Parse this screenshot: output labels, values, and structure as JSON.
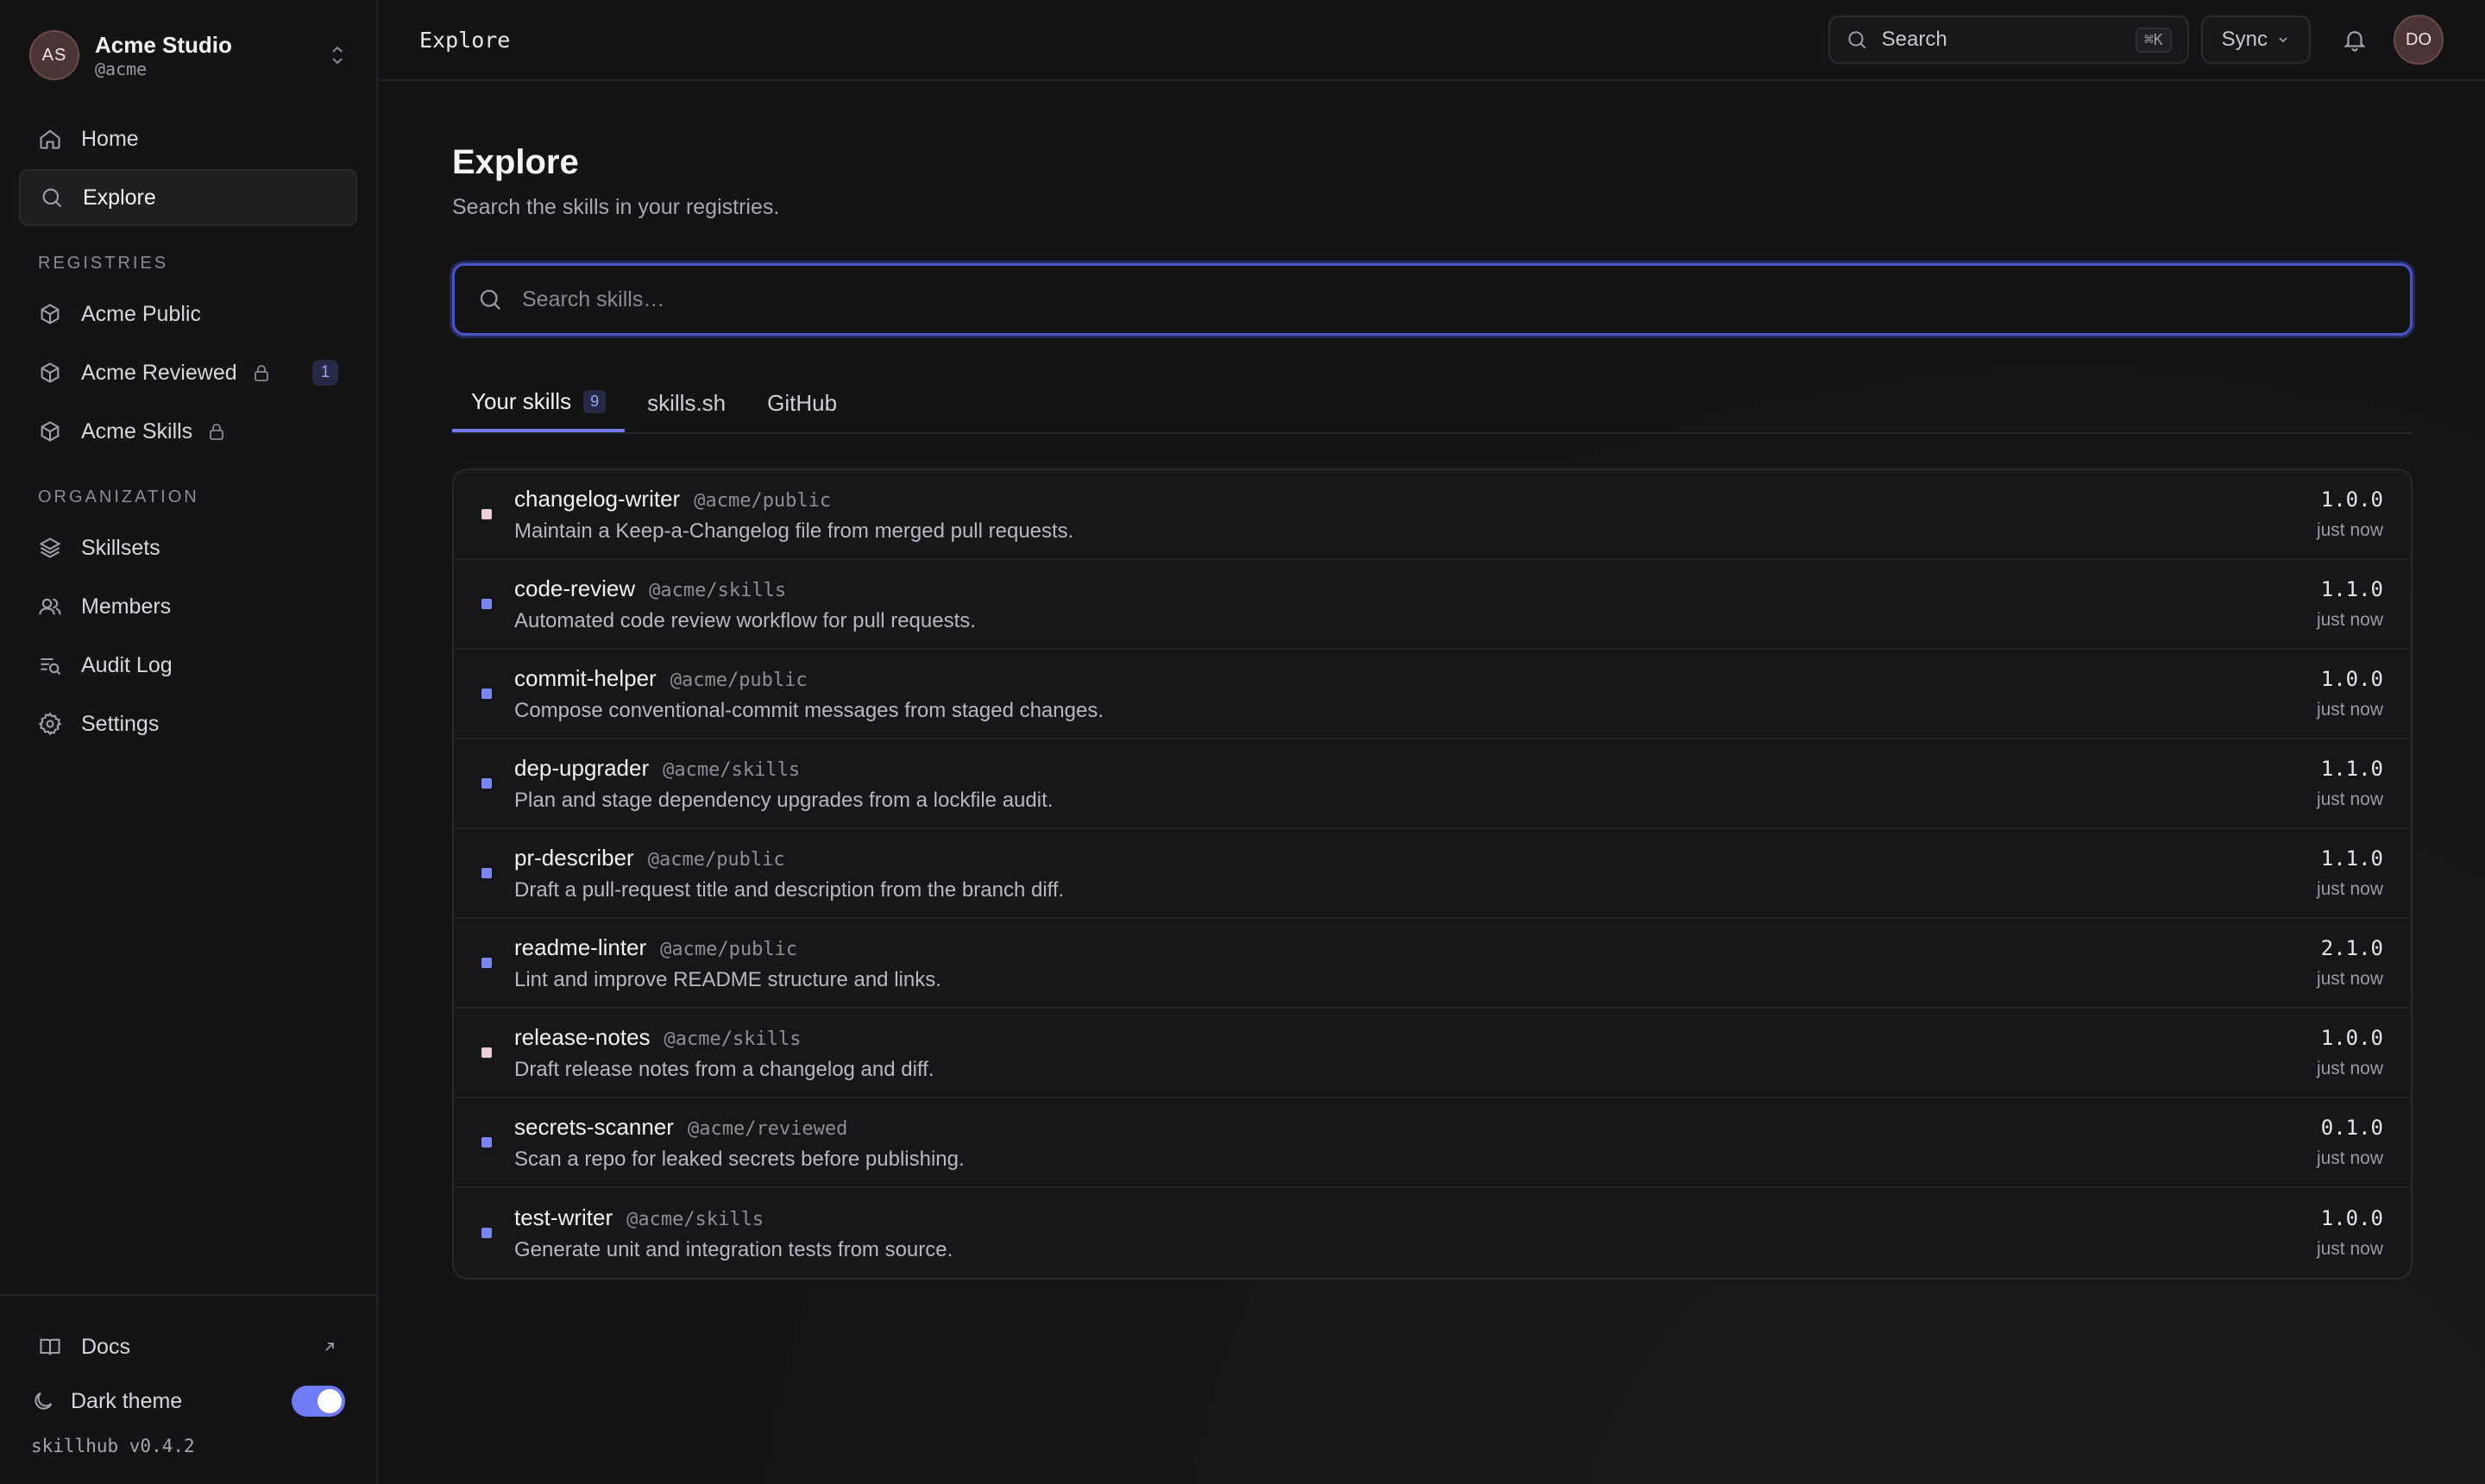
{
  "org": {
    "initials": "AS",
    "name": "Acme Studio",
    "handle": "@acme"
  },
  "nav": [
    {
      "label": "Home",
      "icon": "home-icon"
    },
    {
      "label": "Explore",
      "icon": "search-icon",
      "active": true
    }
  ],
  "registries": {
    "label": "REGISTRIES",
    "items": [
      {
        "label": "Acme Public",
        "icon": "package-icon",
        "locked": false
      },
      {
        "label": "Acme Reviewed",
        "icon": "package-icon",
        "locked": true,
        "count": "1"
      },
      {
        "label": "Acme Skills",
        "icon": "package-icon",
        "locked": true
      }
    ]
  },
  "organization": {
    "label": "ORGANIZATION",
    "items": [
      {
        "label": "Skillsets",
        "icon": "layers-icon"
      },
      {
        "label": "Members",
        "icon": "users-icon"
      },
      {
        "label": "Audit Log",
        "icon": "audit-log-icon"
      },
      {
        "label": "Settings",
        "icon": "gear-icon"
      }
    ]
  },
  "footer": {
    "docs_label": "Docs",
    "theme_label": "Dark theme",
    "theme_on": true,
    "version": "skillhub v0.4.2"
  },
  "topbar": {
    "title": "Explore",
    "search_label": "Search",
    "search_shortcut": "⌘K",
    "sync_label": "Sync",
    "user_initials": "DO"
  },
  "page": {
    "title": "Explore",
    "subtitle": "Search the skills in your registries.",
    "search_placeholder": "Search skills…"
  },
  "tabs": [
    {
      "label": "Your skills",
      "count": "9",
      "active": true
    },
    {
      "label": "skills.sh"
    },
    {
      "label": "GitHub"
    }
  ],
  "colors": {
    "accent": "#6f7cf5",
    "dot_blue": "#7c86f2",
    "dot_pink": "#f0d0d8"
  },
  "skills": [
    {
      "name": "changelog-writer",
      "scope": "@acme/public",
      "desc": "Maintain a Keep-a-Changelog file from merged pull requests.",
      "version": "1.0.0",
      "updated": "just now",
      "dot": "#f0d0d8"
    },
    {
      "name": "code-review",
      "scope": "@acme/skills",
      "desc": "Automated code review workflow for pull requests.",
      "version": "1.1.0",
      "updated": "just now",
      "dot": "#7c86f2"
    },
    {
      "name": "commit-helper",
      "scope": "@acme/public",
      "desc": "Compose conventional-commit messages from staged changes.",
      "version": "1.0.0",
      "updated": "just now",
      "dot": "#7c86f2"
    },
    {
      "name": "dep-upgrader",
      "scope": "@acme/skills",
      "desc": "Plan and stage dependency upgrades from a lockfile audit.",
      "version": "1.1.0",
      "updated": "just now",
      "dot": "#7c86f2"
    },
    {
      "name": "pr-describer",
      "scope": "@acme/public",
      "desc": "Draft a pull-request title and description from the branch diff.",
      "version": "1.1.0",
      "updated": "just now",
      "dot": "#7c86f2"
    },
    {
      "name": "readme-linter",
      "scope": "@acme/public",
      "desc": "Lint and improve README structure and links.",
      "version": "2.1.0",
      "updated": "just now",
      "dot": "#7c86f2"
    },
    {
      "name": "release-notes",
      "scope": "@acme/skills",
      "desc": "Draft release notes from a changelog and diff.",
      "version": "1.0.0",
      "updated": "just now",
      "dot": "#f0d0d8"
    },
    {
      "name": "secrets-scanner",
      "scope": "@acme/reviewed",
      "desc": "Scan a repo for leaked secrets before publishing.",
      "version": "0.1.0",
      "updated": "just now",
      "dot": "#7c86f2"
    },
    {
      "name": "test-writer",
      "scope": "@acme/skills",
      "desc": "Generate unit and integration tests from source.",
      "version": "1.0.0",
      "updated": "just now",
      "dot": "#7c86f2"
    }
  ]
}
